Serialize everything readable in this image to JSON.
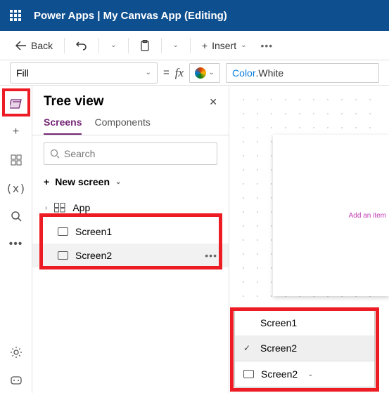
{
  "header": {
    "title": "Power Apps  |  My Canvas App (Editing)"
  },
  "toolbar": {
    "back": "Back",
    "insert": "Insert"
  },
  "formula": {
    "property": "Fill",
    "namespace": "Color",
    "value": "White"
  },
  "tree": {
    "title": "Tree view",
    "tabs": {
      "screens": "Screens",
      "components": "Components"
    },
    "search_placeholder": "Search",
    "new_screen": "New screen",
    "items": {
      "app": "App",
      "screen1": "Screen1",
      "screen2": "Screen2"
    }
  },
  "canvas": {
    "add_item": "Add an item"
  },
  "popup": {
    "screen1": "Screen1",
    "screen2": "Screen2",
    "footer": "Screen2"
  }
}
